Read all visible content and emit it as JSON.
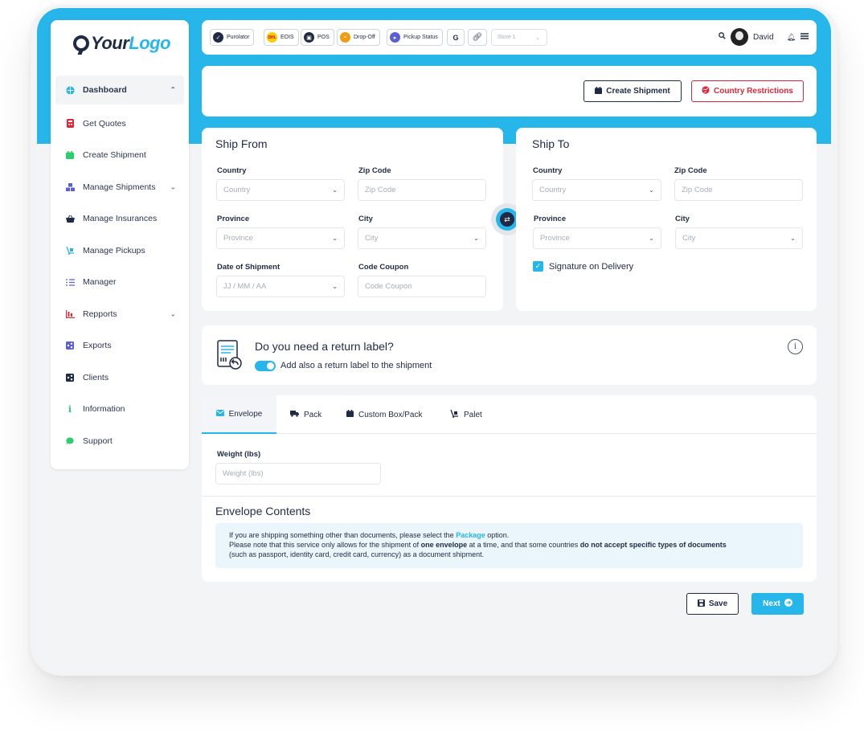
{
  "brand": {
    "your": "Your",
    "logo": "Logo",
    "accent": "#26b6ea",
    "navy": "#1f2a44",
    "danger": "#e0263a"
  },
  "sidebar": {
    "items": [
      {
        "label": "Dashboard",
        "icon": "globe-icon"
      },
      {
        "label": "Get Quotes",
        "icon": "calculator-icon"
      },
      {
        "label": "Create Shipment",
        "icon": "calendar-icon"
      },
      {
        "label": "Manage Shipments",
        "icon": "boxes-icon"
      },
      {
        "label": "Manage Insurances",
        "icon": "basket-icon"
      },
      {
        "label": "Manage Pickups",
        "icon": "dolly-icon"
      },
      {
        "label": "Manager",
        "icon": "checklist-icon"
      },
      {
        "label": "Repports",
        "icon": "bar-chart-icon"
      },
      {
        "label": "Exports",
        "icon": "share-icon"
      },
      {
        "label": "Clients",
        "icon": "share-icon"
      },
      {
        "label": "Information",
        "icon": "info-icon"
      },
      {
        "label": "Support",
        "icon": "chat-icon"
      }
    ]
  },
  "topbar": {
    "shortcuts": [
      "Purolator",
      "EOIS",
      "POS",
      "Drop-Off",
      "Pickup Status",
      "G"
    ],
    "store_placeholder": "Store 1",
    "user_name": "David"
  },
  "actions": {
    "create_shipment": "Create Shipment",
    "country_restrictions": "Country Restrictions"
  },
  "ship_from": {
    "title": "Ship From",
    "country_label": "Country",
    "country_placeholder": "Country",
    "zip_label": "Zip Code",
    "zip_placeholder": "Zip Code",
    "province_label": "Province",
    "province_placeholder": "Province",
    "city_label": "City",
    "city_placeholder": "City",
    "date_label": "Date of Shipment",
    "date_placeholder": "JJ / MM / AA",
    "coupon_label": "Code Coupon",
    "coupon_placeholder": "Code Coupon"
  },
  "ship_to": {
    "title": "Ship To",
    "country_label": "Country",
    "country_placeholder": "Country",
    "zip_label": "Zip Code",
    "zip_placeholder": "Zip Code",
    "province_label": "Province",
    "province_placeholder": "Province",
    "city_label": "City",
    "city_placeholder": "City",
    "signature_label": "Signature on Delivery",
    "signature_checked": true
  },
  "return_label": {
    "question": "Do you need a return label?",
    "toggle_label": "Add also a return label to the shipment",
    "toggle_on": true,
    "info": "i"
  },
  "package_tabs": [
    {
      "label": "Envelope",
      "icon": "envelope-icon",
      "active": true
    },
    {
      "label": "Pack",
      "icon": "truck-icon",
      "active": false
    },
    {
      "label": "Custom Box/Pack",
      "icon": "box-icon",
      "active": false
    },
    {
      "label": "Palet",
      "icon": "dolly-icon",
      "active": false
    }
  ],
  "weight": {
    "label": "Weight (lbs)",
    "placeholder": "Weight (lbs)"
  },
  "envelope_contents": {
    "title": "Envelope Contents",
    "line1_a": "If you are shipping something other than documents, please select the ",
    "line1_link": "Package",
    "line1_b": " option.",
    "line2_a": "Please note that this service only allows for the shipment of ",
    "line2_b1": "one envelope",
    "line2_c": " at a time, and that some countries ",
    "line2_b2": "do not accept specific types of documents",
    "line3": "(such as passport, identity card, credit card, currency) as a document shipment."
  },
  "footer": {
    "save": "Save",
    "next": "Next"
  }
}
